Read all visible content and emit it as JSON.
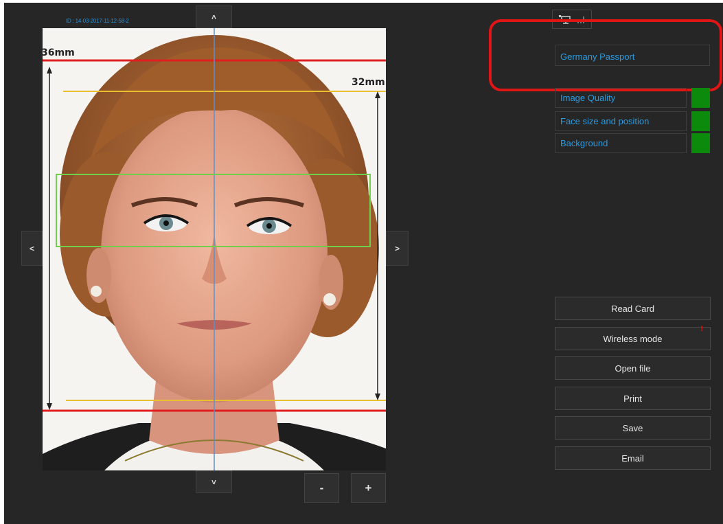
{
  "photo": {
    "id_label": "ID : 14-03-2017-11-12-58-2",
    "width_mm": "36mm",
    "height_mm": "32mm"
  },
  "navigation": {
    "up": "˄",
    "down": "˅",
    "left": "<",
    "right": ">",
    "zoom_out": "-",
    "zoom_in": "+"
  },
  "document_type": "Germany Passport",
  "checks": [
    {
      "label": "Image Quality",
      "status_color": "#0c8a0c"
    },
    {
      "label": "Face size and position",
      "status_color": "#0c8a0c"
    },
    {
      "label": "Background",
      "status_color": "#0c8a0c"
    }
  ],
  "actions": {
    "read_card": "Read Card",
    "wireless_mode": "Wireless mode",
    "wireless_alert": "!",
    "open_file": "Open file",
    "print": "Print",
    "save": "Save",
    "email": "Email"
  },
  "colors": {
    "accent": "#2a9be0",
    "ok": "#0c8a0c",
    "highlight": "#e01515"
  }
}
